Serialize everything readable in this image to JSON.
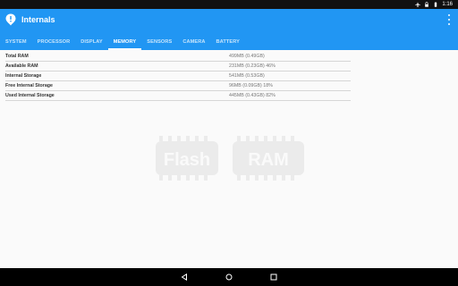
{
  "status_bar": {
    "time": "1:16",
    "icons": [
      "airplane-icon",
      "lock-icon",
      "battery-icon"
    ]
  },
  "app": {
    "title": "Internals",
    "accent_color": "#2196f3",
    "tabs": [
      {
        "label": "SYSTEM",
        "active": false
      },
      {
        "label": "PROCESSOR",
        "active": false
      },
      {
        "label": "DISPLAY",
        "active": false
      },
      {
        "label": "MEMORY",
        "active": true
      },
      {
        "label": "SENSORS",
        "active": false
      },
      {
        "label": "CAMERA",
        "active": false
      },
      {
        "label": "BATTERY",
        "active": false
      }
    ]
  },
  "memory": {
    "rows": [
      {
        "label": "Total RAM",
        "value": "499MB (0.49GB)"
      },
      {
        "label": "Available RAM",
        "value": "231MB (0.23GB) 46%"
      },
      {
        "label": "Internal Storage",
        "value": "541MB (0.53GB)"
      },
      {
        "label": "Free Internal Storage",
        "value": "96MB (0.09GB) 18%"
      },
      {
        "label": "Used Internal Storage",
        "value": "445MB (0.43GB) 82%"
      }
    ]
  },
  "watermark": {
    "chip1": "Flash",
    "chip2": "RAM"
  },
  "nav_bar": {
    "icons": [
      "back-icon",
      "home-icon",
      "recents-icon"
    ]
  }
}
